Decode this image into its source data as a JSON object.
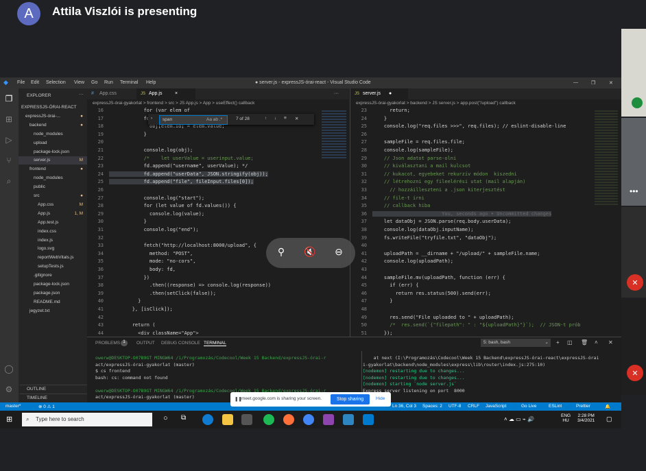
{
  "meet": {
    "avatar_letter": "A",
    "presenter_text": "Attila Viszlói is presenting",
    "share_notice": "meet.google.com is sharing your screen.",
    "stop_sharing": "Stop sharing",
    "hide": "Hide"
  },
  "vscode": {
    "menu": [
      "File",
      "Edit",
      "Selection",
      "View",
      "Go",
      "Run",
      "Terminal",
      "Help"
    ],
    "window_title": "● server.js - expressJS-órai-react - Visual Studio Code",
    "explorer_title": "EXPLORER",
    "tree": [
      {
        "label": "EXPRESSJS-ÓRAI-REACT",
        "indent": 0,
        "badge": ""
      },
      {
        "label": "expressJS-órai-...",
        "indent": 1,
        "badge": "●"
      },
      {
        "label": "backend",
        "indent": 2,
        "badge": "●"
      },
      {
        "label": "node_modules",
        "indent": 3,
        "badge": ""
      },
      {
        "label": "upload",
        "indent": 3,
        "badge": ""
      },
      {
        "label": "package-lock.json",
        "indent": 3,
        "badge": ""
      },
      {
        "label": "server.js",
        "indent": 3,
        "badge": "M"
      },
      {
        "label": "frontend",
        "indent": 2,
        "badge": "●"
      },
      {
        "label": "node_modules",
        "indent": 3,
        "badge": ""
      },
      {
        "label": "public",
        "indent": 3,
        "badge": ""
      },
      {
        "label": "src",
        "indent": 3,
        "badge": "●"
      },
      {
        "label": "App.css",
        "indent": 4,
        "badge": "M"
      },
      {
        "label": "App.js",
        "indent": 4,
        "badge": "1, M"
      },
      {
        "label": "App.test.js",
        "indent": 4,
        "badge": ""
      },
      {
        "label": "index.css",
        "indent": 4,
        "badge": ""
      },
      {
        "label": "index.js",
        "indent": 4,
        "badge": ""
      },
      {
        "label": "logo.svg",
        "indent": 4,
        "badge": ""
      },
      {
        "label": "reportWebVitals.js",
        "indent": 4,
        "badge": ""
      },
      {
        "label": "setupTests.js",
        "indent": 4,
        "badge": ""
      },
      {
        "label": ".gitignore",
        "indent": 3,
        "badge": ""
      },
      {
        "label": "package-lock.json",
        "indent": 3,
        "badge": ""
      },
      {
        "label": "package.json",
        "indent": 3,
        "badge": ""
      },
      {
        "label": "README.md",
        "indent": 3,
        "badge": ""
      },
      {
        "label": "jegyzet.txt",
        "indent": 2,
        "badge": ""
      }
    ],
    "outline": "OUTLINE",
    "timeline": "TIMELINE",
    "left_tabs": [
      "App.css",
      "App.js"
    ],
    "left_breadcrumb": "expressJS-órai-gyakorlat > frontend > src > JS App.js > App > useEffect() callback",
    "find_query": "span",
    "find_count": "7 of 28",
    "find_opts": "Aa ab .*",
    "left_code": [
      {
        "n": "16",
        "t": "            for (var elem of"
      },
      {
        "n": "17",
        "t": "            for"
      },
      {
        "n": "18",
        "t": "              obj[elem.id] = elem.value;"
      },
      {
        "n": "19",
        "t": "            }"
      },
      {
        "n": "20",
        "t": ""
      },
      {
        "n": "21",
        "t": "            console.log(obj);"
      },
      {
        "n": "22",
        "t": "            /*    let userValue = userinput.value;"
      },
      {
        "n": "23",
        "t": "            fd.append(\"username\", userValue); */"
      },
      {
        "n": "24",
        "t": "            fd.append(\"userData\", JSON.stringify(obj));"
      },
      {
        "n": "25",
        "t": "            fd.append(\"file\", fileInput.files[0]);"
      },
      {
        "n": "26",
        "t": ""
      },
      {
        "n": "27",
        "t": "            console.log(\"start\");"
      },
      {
        "n": "28",
        "t": "            for (let value of fd.values()) {"
      },
      {
        "n": "29",
        "t": "              console.log(value);"
      },
      {
        "n": "30",
        "t": "            }"
      },
      {
        "n": "31",
        "t": "            console.log(\"end\");"
      },
      {
        "n": "32",
        "t": ""
      },
      {
        "n": "33",
        "t": "            fetch(\"http://localhost:8000/upload\", {"
      },
      {
        "n": "34",
        "t": "              method: \"POST\","
      },
      {
        "n": "35",
        "t": "              mode: \"no-cors\","
      },
      {
        "n": "36",
        "t": "              body: fd,"
      },
      {
        "n": "37",
        "t": "            })"
      },
      {
        "n": "38",
        "t": "              .then((response) => console.log(response))"
      },
      {
        "n": "39",
        "t": "              .then(setClick(false));"
      },
      {
        "n": "40",
        "t": "          }"
      },
      {
        "n": "41",
        "t": "        }, [isClick]);"
      },
      {
        "n": "42",
        "t": ""
      },
      {
        "n": "43",
        "t": "        return ("
      },
      {
        "n": "44",
        "t": "          <div className=\"App\">"
      }
    ],
    "right_tab": "server.js",
    "right_breadcrumb": "expressJS-órai-gyakorlat > backend > JS server.js > app.post(\"/upload\") callback",
    "right_code": [
      {
        "n": "23",
        "t": "      return;"
      },
      {
        "n": "24",
        "t": "    }"
      },
      {
        "n": "25",
        "t": "    console.log(\"req.files >>>\", req.files); // eslint-disable-line"
      },
      {
        "n": "26",
        "t": ""
      },
      {
        "n": "27",
        "t": "    sampleFile = req.files.file;"
      },
      {
        "n": "28",
        "t": "    console.log(sampleFile);"
      },
      {
        "n": "29",
        "t": "    // Json adatot parse-olni"
      },
      {
        "n": "30",
        "t": "    // kiválasztani a mail kulcsot"
      },
      {
        "n": "31",
        "t": "    // kukacot, egyebeket rekurzív módon  kiszedni"
      },
      {
        "n": "32",
        "t": "    // létrehozni egy fileelérési utat (mail alapján)"
      },
      {
        "n": "33",
        "t": "      // hozzáilleszteni a .json kiterjesztést"
      },
      {
        "n": "34",
        "t": "    // file-t írni"
      },
      {
        "n": "35",
        "t": "    // callback hiba"
      },
      {
        "n": "36",
        "t": "                        You, seconds ago • Uncommitted changes"
      },
      {
        "n": "37",
        "t": "    let dataObj = JSON.parse(req.body.userData);"
      },
      {
        "n": "38",
        "t": "    console.log(dataObj.inputName);"
      },
      {
        "n": "39",
        "t": "    fs.writeFile(\"tryfile.txt\", \"dataObj\");"
      },
      {
        "n": "40",
        "t": ""
      },
      {
        "n": "41",
        "t": "    uploadPath = __dirname + \"/upload/\" + sampleFile.name;"
      },
      {
        "n": "42",
        "t": "    console.log(uploadPath);"
      },
      {
        "n": "43",
        "t": ""
      },
      {
        "n": "44",
        "t": "    sampleFile.mv(uploadPath, function (err) {"
      },
      {
        "n": "45",
        "t": "      if (err) {"
      },
      {
        "n": "46",
        "t": "        return res.status(500).send(err);"
      },
      {
        "n": "47",
        "t": "      }"
      },
      {
        "n": "48",
        "t": ""
      },
      {
        "n": "49",
        "t": "      res.send(\"File uploaded to \" + uploadPath);"
      },
      {
        "n": "50",
        "t": "      /*  res.send(`{\"filepath\": \" : \"${uploadPath}\"}`);  // JSON-t prób"
      },
      {
        "n": "51",
        "t": "    });"
      }
    ],
    "panel_tabs": [
      "PROBLEMS",
      "OUTPUT",
      "DEBUG CONSOLE",
      "TERMINAL"
    ],
    "problems_count": "1",
    "terminal_select": "5: bash, bash",
    "term_left": [
      "owerw@DESKTOP-O07B9GT MINGW64 /i/Programozás/Codecool/Week 15 Backend/expressJS-órai-r",
      "act/expressJS-órai-gyakorlat (master)",
      "$ cs frontend",
      "bash: cs: command not found",
      "",
      "owerw@DESKTOP-O07B9GT MINGW64 /i/Programozás/Codecool/Week 15 Backend/expressJS-órai-r",
      "act/expressJS-órai-gyakorlat (master)"
    ],
    "term_right": [
      "    at next (I:\\Programozás\\Codecool\\Week 15 Backend\\expressJS-órai-react\\expressJS-órai",
      "i-gyakorlat\\backend\\node_modules\\express\\lib\\router\\index.js:275:10)",
      "[nodemon] restarting due to changes...",
      "[nodemon] restarting due to changes...",
      "[nodemon] starting `node server.js`",
      "Express server listening on port  8000"
    ],
    "status": {
      "branch": "master*",
      "errors": "⊗ 0 ⚠ 1",
      "position": "Ln 36, Col 3",
      "spaces": "Spaces: 2",
      "encoding": "UTF-8",
      "eol": "CRLF",
      "language": "JavaScript",
      "golive": "Go Live",
      "eslint": "ESLint",
      "prettier": "Prettier",
      "blame": "You, seconds ago"
    }
  },
  "taskbar": {
    "search_placeholder": "Type here to search",
    "lang": "ENG",
    "lang2": "HU",
    "time": "2:28 PM",
    "date": "3/4/2021"
  }
}
